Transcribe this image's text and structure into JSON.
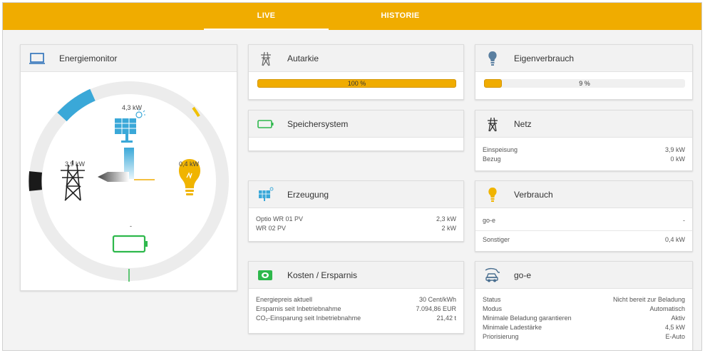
{
  "tabs": {
    "live": "LIVE",
    "historie": "HISTORIE"
  },
  "energiemonitor": {
    "title": "Energiemonitor",
    "solar_value": "4,3 kW",
    "grid_value": "3,9 kW",
    "house_value": "0,4 kW",
    "battery_value": "-"
  },
  "autarkie": {
    "title": "Autarkie",
    "percent_label": "100 %",
    "value": 1.0
  },
  "eigenverbrauch": {
    "title": "Eigenverbrauch",
    "percent_label": "9 %",
    "value": 0.09
  },
  "speicher": {
    "title": "Speichersystem"
  },
  "netz": {
    "title": "Netz",
    "rows": [
      {
        "label": "Einspeisung",
        "value": "3,9 kW"
      },
      {
        "label": "Bezug",
        "value": "0 kW"
      }
    ]
  },
  "erzeugung": {
    "title": "Erzeugung",
    "rows": [
      {
        "label": "Optio WR 01 PV",
        "value": "2,3 kW"
      },
      {
        "label": "WR 02 PV",
        "value": "2 kW"
      }
    ]
  },
  "verbrauch": {
    "title": "Verbrauch",
    "rows": [
      {
        "label": "go-e",
        "value": "-"
      },
      {
        "label": "Sonstiger",
        "value": "0,4 kW"
      }
    ]
  },
  "kosten": {
    "title": "Kosten / Ersparnis",
    "rows": [
      {
        "label": "Energiepreis aktuell",
        "value": "30 Cent/kWh"
      },
      {
        "label": "Ersparnis seit Inbetriebnahme",
        "value": "7.094,86 EUR"
      },
      {
        "label": "CO₂-Einsparung seit Inbetriebnahme",
        "value": "21,42 t"
      }
    ]
  },
  "goe": {
    "title": "go-e",
    "rows": [
      {
        "label": "Status",
        "value": "Nicht bereit zur Beladung"
      },
      {
        "label": "Modus",
        "value": "Automatisch"
      },
      {
        "label": "Minimale Beladung garantieren",
        "value": "Aktiv"
      },
      {
        "label": "Minimale Ladestärke",
        "value": "4,5 kW"
      },
      {
        "label": "Priorisierung",
        "value": "E-Auto"
      }
    ]
  },
  "colors": {
    "accent": "#f0ac00",
    "solar": "#3aa8d8",
    "battery": "#2eb84c",
    "grid": "#222222"
  },
  "icons": {
    "energiemonitor": "monitor-icon",
    "autarkie": "power-tower-icon",
    "eigenverbrauch": "bulb-icon",
    "speicher": "battery-icon",
    "netz": "power-tower-icon",
    "erzeugung": "solar-panel-icon",
    "verbrauch": "bulb-icon",
    "kosten": "money-icon",
    "goe": "car-charger-icon"
  }
}
